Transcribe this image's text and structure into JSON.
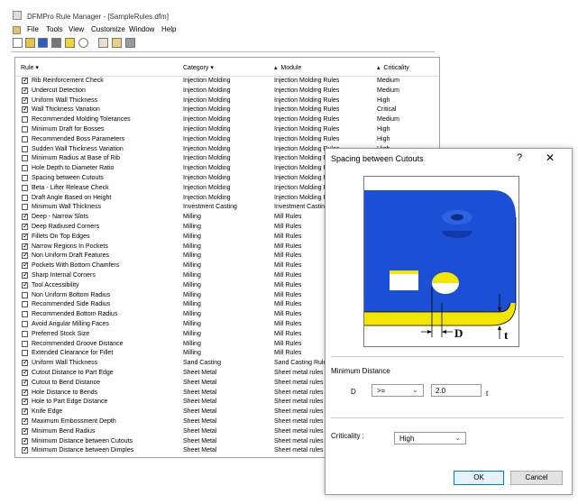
{
  "window": {
    "title": "DFMPro Rule Manager - [SampleRules.dfm]"
  },
  "menu": [
    "File",
    "Tools",
    "View",
    "Customize",
    "Window",
    "Help"
  ],
  "toolbar_icons": [
    "new-icon",
    "open-icon",
    "save-icon",
    "stop-icon",
    "help-icon",
    "find-icon",
    "properties-icon",
    "report-icon",
    "blank-icon"
  ],
  "list": {
    "headers": {
      "rule": "Rule",
      "category": "Category",
      "module": "Module",
      "criticality": "Criticality"
    },
    "rows": [
      {
        "on": true,
        "rule": "Rib Reinforcement Check",
        "cat": "Injection Molding",
        "mod": "Injection Molding Rules",
        "crit": "Medium"
      },
      {
        "on": true,
        "rule": "Undercut Detection",
        "cat": "Injection Molding",
        "mod": "Injection Molding Rules",
        "crit": "Medium"
      },
      {
        "on": true,
        "rule": "Uniform Wall Thickness",
        "cat": "Injection Molding",
        "mod": "Injection Molding Rules",
        "crit": "High"
      },
      {
        "on": true,
        "rule": "Wall Thickness Variation",
        "cat": "Injection Molding",
        "mod": "Injection Molding Rules",
        "crit": "Critical"
      },
      {
        "on": false,
        "rule": "Recommended Molding Tolerances",
        "cat": "Injection Molding",
        "mod": "Injection Molding Rules",
        "crit": "Medium"
      },
      {
        "on": false,
        "rule": "Minimum Draft for Bosses",
        "cat": "Injection Molding",
        "mod": "Injection Molding Rules",
        "crit": "High"
      },
      {
        "on": false,
        "rule": "Recommended Boss Parameters",
        "cat": "Injection Molding",
        "mod": "Injection Molding Rules",
        "crit": "High"
      },
      {
        "on": false,
        "rule": "Sudden Wall Thickness Variation",
        "cat": "Injection Molding",
        "mod": "Injection Molding Rules",
        "crit": "High"
      },
      {
        "on": false,
        "rule": "Minimum Radius at Base of Rib",
        "cat": "Injection Molding",
        "mod": "Injection Molding R",
        "crit": ""
      },
      {
        "on": false,
        "rule": "Hole Depth to Diameter Ratio",
        "cat": "Injection Molding",
        "mod": "Injection Molding R",
        "crit": ""
      },
      {
        "on": false,
        "rule": "Spacing between Cutouts",
        "cat": "Injection Molding",
        "mod": "Injection Molding R",
        "crit": ""
      },
      {
        "on": false,
        "rule": "Beta - Lifter Release Check",
        "cat": "Injection Molding",
        "mod": "Injection Molding R",
        "crit": ""
      },
      {
        "on": false,
        "rule": "Draft Angle Based on Height",
        "cat": "Injection Molding",
        "mod": "Injection Molding R",
        "crit": ""
      },
      {
        "on": false,
        "rule": "Minimum Wall Thickness",
        "cat": "Investment Casting",
        "mod": "Investment Casting",
        "crit": ""
      },
      {
        "on": true,
        "rule": "Deep - Narrow Slots",
        "cat": "Milling",
        "mod": "Mill Rules",
        "crit": ""
      },
      {
        "on": true,
        "rule": "Deep Radiused Corners",
        "cat": "Milling",
        "mod": "Mill Rules",
        "crit": ""
      },
      {
        "on": true,
        "rule": "Fillets On Top Edges",
        "cat": "Milling",
        "mod": "Mill Rules",
        "crit": ""
      },
      {
        "on": true,
        "rule": "Narrow Regions In Pockets",
        "cat": "Milling",
        "mod": "Mill Rules",
        "crit": ""
      },
      {
        "on": true,
        "rule": "Non Uniform Draft Features",
        "cat": "Milling",
        "mod": "Mill Rules",
        "crit": ""
      },
      {
        "on": true,
        "rule": "Pockets With Bottom Chamfers",
        "cat": "Milling",
        "mod": "Mill Rules",
        "crit": ""
      },
      {
        "on": true,
        "rule": "Sharp Internal Corners",
        "cat": "Milling",
        "mod": "Mill Rules",
        "crit": ""
      },
      {
        "on": true,
        "rule": "Tool Accessibility",
        "cat": "Milling",
        "mod": "Mill Rules",
        "crit": ""
      },
      {
        "on": false,
        "rule": "Non Uniform Bottom Radius",
        "cat": "Milling",
        "mod": "Mill Rules",
        "crit": ""
      },
      {
        "on": false,
        "rule": "Recommended Side Radius",
        "cat": "Milling",
        "mod": "Mill Rules",
        "crit": ""
      },
      {
        "on": false,
        "rule": "Recommended Bottom Radius",
        "cat": "Milling",
        "mod": "Mill Rules",
        "crit": ""
      },
      {
        "on": false,
        "rule": "Avoid Angular Milling Faces",
        "cat": "Milling",
        "mod": "Mill Rules",
        "crit": ""
      },
      {
        "on": false,
        "rule": "Preferred Stock Size",
        "cat": "Milling",
        "mod": "Mill Rules",
        "crit": ""
      },
      {
        "on": false,
        "rule": "Recommended Groove Distance",
        "cat": "Milling",
        "mod": "Mill Rules",
        "crit": ""
      },
      {
        "on": false,
        "rule": "Extended Clearance for Fillet",
        "cat": "Milling",
        "mod": "Mill Rules",
        "crit": ""
      },
      {
        "on": true,
        "rule": "Uniform Wall Thickness",
        "cat": "Sand Casting",
        "mod": "Sand Casting Rule",
        "crit": ""
      },
      {
        "on": true,
        "rule": "Cutout Distance to Part Edge",
        "cat": "Sheet Metal",
        "mod": "Sheet metal rules",
        "crit": ""
      },
      {
        "on": true,
        "rule": "Cutout to Bend Distance",
        "cat": "Sheet Metal",
        "mod": "Sheet metal rules",
        "crit": ""
      },
      {
        "on": true,
        "rule": "Hole Distance to Bends",
        "cat": "Sheet Metal",
        "mod": "Sheet metal rules",
        "crit": ""
      },
      {
        "on": true,
        "rule": "Hole to Part Edge Distance",
        "cat": "Sheet Metal",
        "mod": "Sheet metal rules",
        "crit": ""
      },
      {
        "on": true,
        "rule": "Knife Edge",
        "cat": "Sheet Metal",
        "mod": "Sheet metal rules",
        "crit": ""
      },
      {
        "on": true,
        "rule": "Maximum Embossment Depth",
        "cat": "Sheet Metal",
        "mod": "Sheet metal rules",
        "crit": ""
      },
      {
        "on": true,
        "rule": "Minimum Bend Radius",
        "cat": "Sheet Metal",
        "mod": "Sheet metal rules",
        "crit": ""
      },
      {
        "on": true,
        "rule": "Minimum Distance between Cutouts",
        "cat": "Sheet Metal",
        "mod": "Sheet metal rules",
        "crit": ""
      },
      {
        "on": true,
        "rule": "Minimum Distance between Dimples",
        "cat": "Sheet Metal",
        "mod": "Sheet metal rules",
        "crit": ""
      }
    ]
  },
  "dialog": {
    "title": "Spacing between Cutouts",
    "help": "?",
    "close": "✕",
    "illus_labels": {
      "d": "D",
      "t": "t"
    },
    "colors": {
      "blue": "#1a4fd6",
      "yellow": "#f2e600"
    },
    "min_distance_label": "Minimum Distance",
    "param_label": "D",
    "operator": ">=",
    "value": "2.0",
    "unit": "t",
    "criticality_label": "Criticality :",
    "criticality_value": "High",
    "ok": "OK",
    "cancel": "Cancel"
  }
}
